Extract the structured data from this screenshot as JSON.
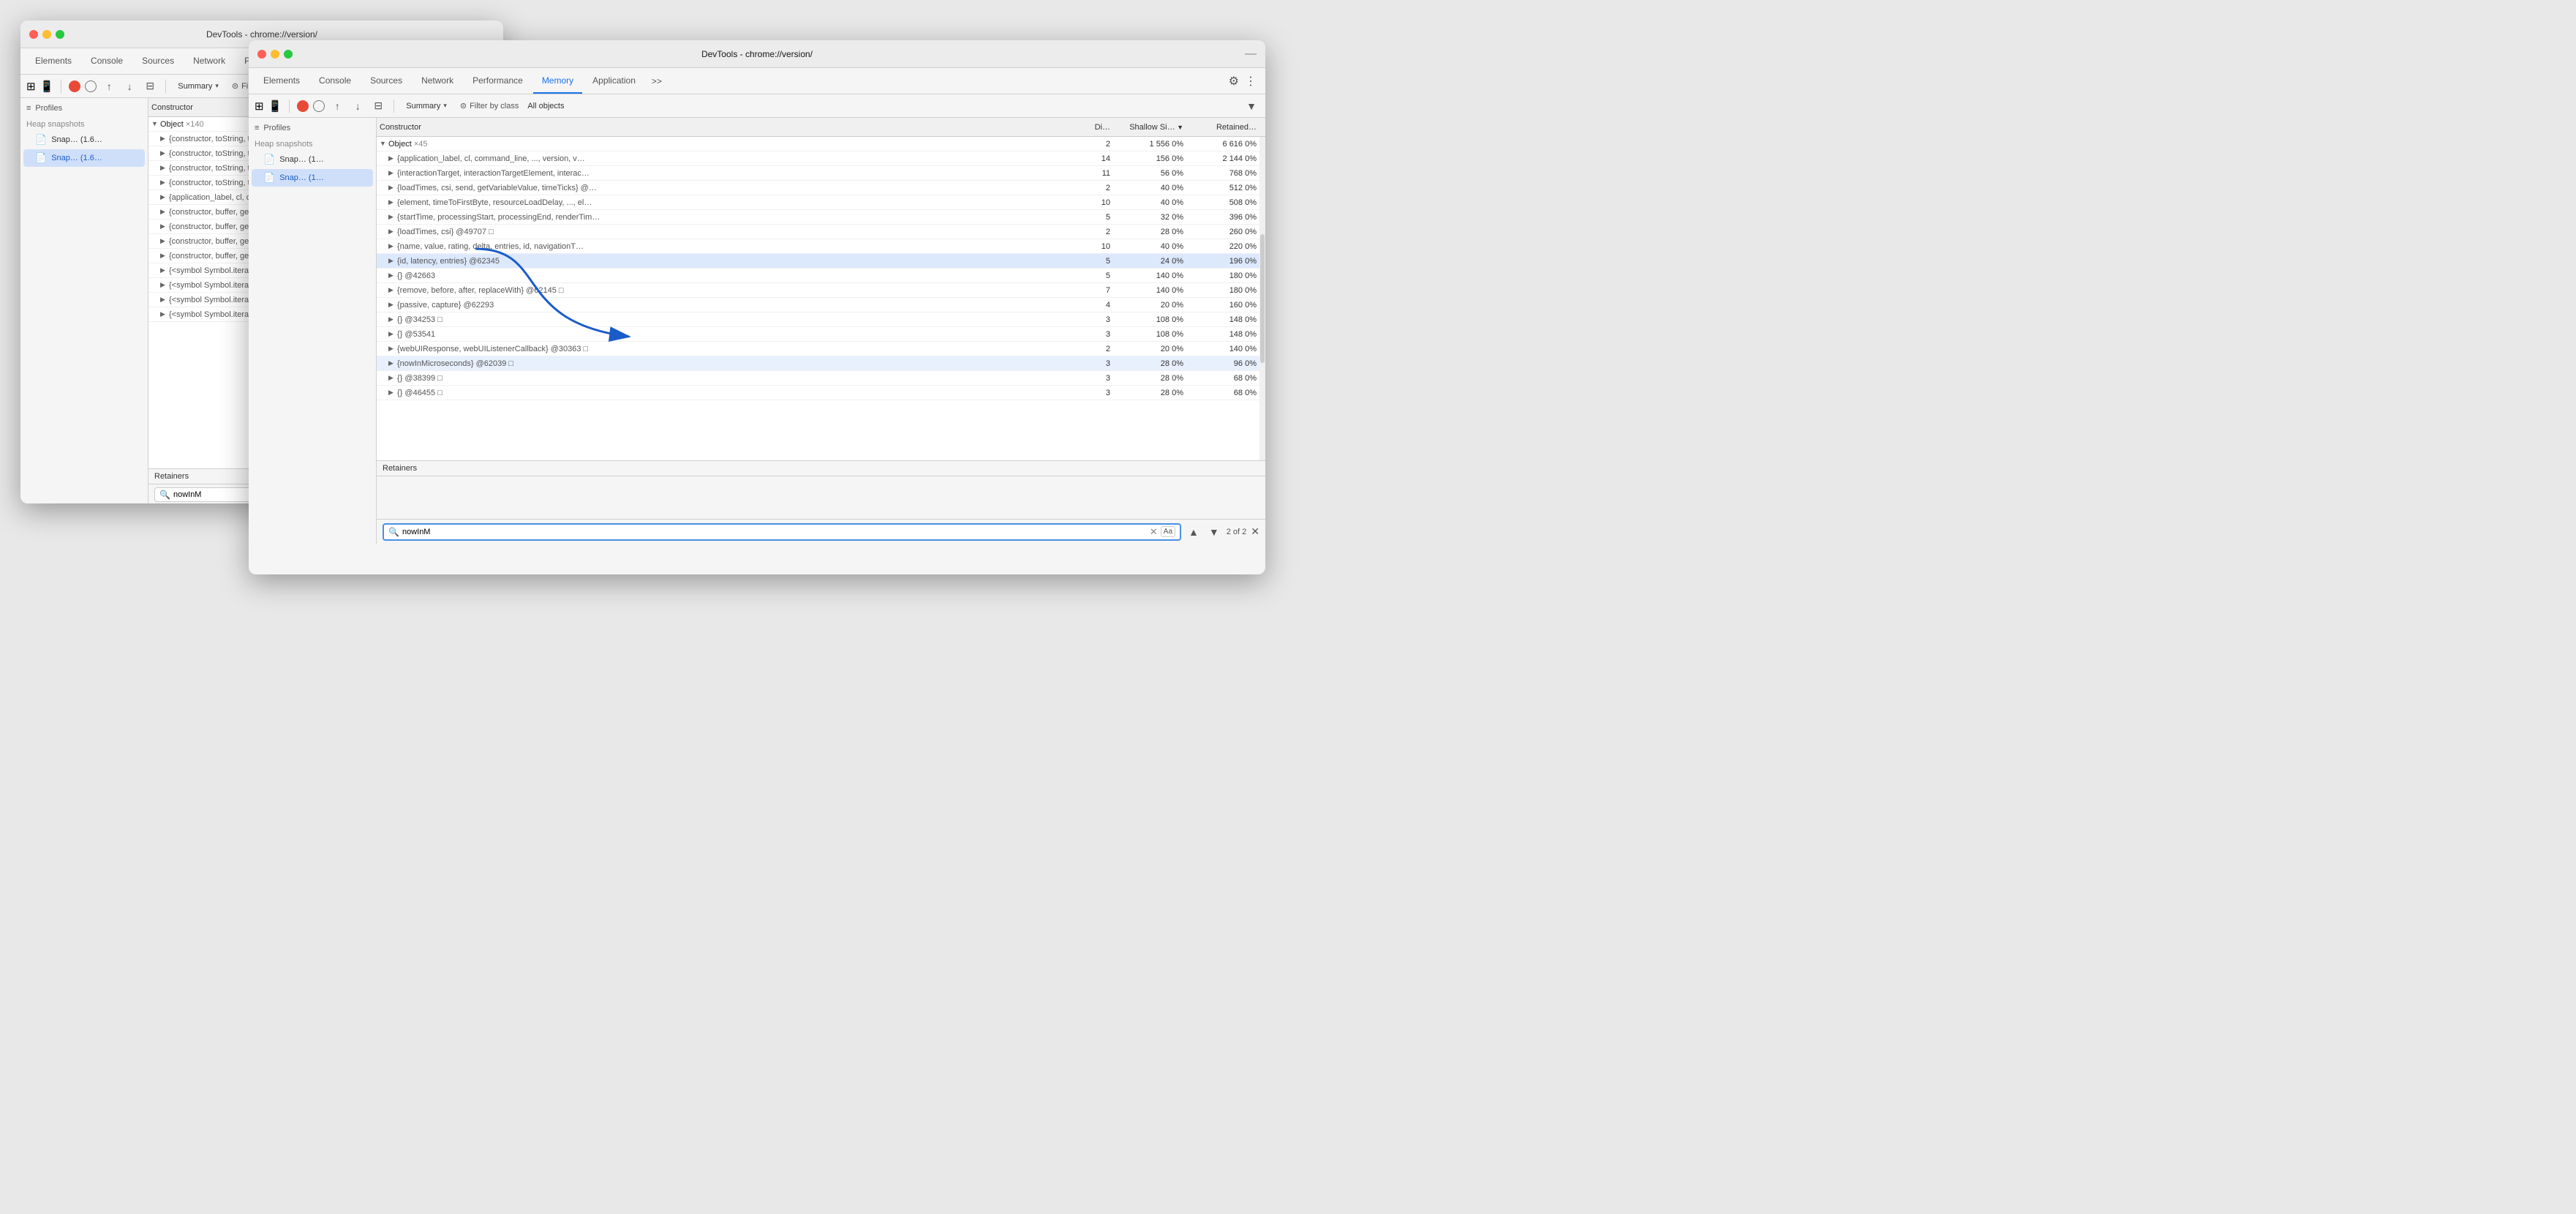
{
  "window1": {
    "title": "DevTools - chrome://version/",
    "tabs": [
      "Elements",
      "Console",
      "Sources",
      "Network",
      "Performance",
      "Memory",
      "Application",
      ">>"
    ],
    "activeTab": "Memory",
    "toolbar": {
      "summary_label": "Summary",
      "filter_label": "Filter by class",
      "all_objects_label": "All objects"
    },
    "sidebar": {
      "profiles_label": "Profiles",
      "heap_snapshots_label": "Heap snapshots",
      "snap1_label": "Snap… (1.6…",
      "snap2_label": "Snap… (1.6…"
    },
    "constructor_header": "Constructor",
    "object_label": "Object",
    "object_count": "×140",
    "rows": [
      "{constructor, toString, toDateString, ..., toLocaleT…",
      "{constructor, toString, toDateString, ..., toLocaleT…",
      "{constructor, toString, toDateString, ..., toLocaleT…",
      "{constructor, toString, toDateString, ..., toLocaleT…",
      "{application_label, cl, command_line, ..., version, …",
      "{constructor, buffer, get buffer, byteLength, get by…",
      "{constructor, buffer, get buffer, byteLength, get by…",
      "{constructor, buffer, get buffer, byteLength, get by…",
      "{constructor, buffer, get buffer, byteLength, get by…",
      "{<symbol Symbol.iterator>, constructor, get construct…",
      "{<symbol Symbol.iterator>, constructor, get construct…",
      "{<symbol Symbol.iterator>, constructor, get construct…",
      "{<symbol Symbol.iterator>, constructor, get construct…"
    ],
    "retainers_label": "Retainers",
    "search_value": "nowInM"
  },
  "window2": {
    "title": "DevTools - chrome://version/",
    "tabs": [
      "Elements",
      "Console",
      "Sources",
      "Network",
      "Performance",
      "Memory",
      "Application",
      ">>"
    ],
    "activeTab": "Memory",
    "toolbar": {
      "summary_label": "Summary",
      "filter_label": "Filter by class",
      "all_objects_label": "All objects"
    },
    "sidebar": {
      "profiles_label": "Profiles",
      "heap_snapshots_label": "Heap snapshots",
      "snap1_label": "Snap… (1…",
      "snap2_label": "Snap… (1…"
    },
    "columns": {
      "constructor": "Constructor",
      "distance": "Di…",
      "shallow": "Shallow Si…",
      "retained": "Retained…"
    },
    "object_label": "Object",
    "object_count": "×45",
    "rows": [
      {
        "label": "{application_label, cl, command_line, ..., version, v…",
        "di": "14",
        "shallow": "156  0%",
        "retained": "2 144  0%"
      },
      {
        "label": "{interactionTarget, interactionTargetElement, interac…",
        "di": "11",
        "shallow": "56  0%",
        "retained": "768  0%"
      },
      {
        "label": "{loadTimes, csi, send, getVariableValue, timeTicks} @…",
        "di": "2",
        "shallow": "40  0%",
        "retained": "512  0%"
      },
      {
        "label": "{element, timeToFirstByte, resourceLoadDelay, ..., el…",
        "di": "10",
        "shallow": "40  0%",
        "retained": "508  0%"
      },
      {
        "label": "{startTime, processingStart, processingEnd, renderTim…",
        "di": "5",
        "shallow": "32  0%",
        "retained": "396  0%"
      },
      {
        "label": "{loadTimes, csi} @49707 □",
        "di": "2",
        "shallow": "28  0%",
        "retained": "260  0%"
      },
      {
        "label": "{name, value, rating, delta, entries, id, navigationT…",
        "di": "10",
        "shallow": "40  0%",
        "retained": "220  0%"
      },
      {
        "label": "{id, latency, entries} @62345",
        "di": "5",
        "shallow": "24  0%",
        "retained": "196  0%",
        "highlighted": true
      },
      {
        "label": "{} @42663",
        "di": "5",
        "shallow": "140  0%",
        "retained": "180  0%"
      },
      {
        "label": "{remove, before, after, replaceWith} @62145 □",
        "di": "7",
        "shallow": "140  0%",
        "retained": "180  0%"
      },
      {
        "label": "{passive, capture} @62293",
        "di": "4",
        "shallow": "20  0%",
        "retained": "160  0%"
      },
      {
        "label": "{} @34253 □",
        "di": "3",
        "shallow": "108  0%",
        "retained": "148  0%"
      },
      {
        "label": "{} @53541",
        "di": "3",
        "shallow": "108  0%",
        "retained": "148  0%"
      },
      {
        "label": "{webUIResponse, webUIListenerCallback} @30363 □",
        "di": "2",
        "shallow": "20  0%",
        "retained": "140  0%"
      },
      {
        "label": "{nowInMicroseconds} @62039 □",
        "di": "3",
        "shallow": "28  0%",
        "retained": "96  0%",
        "highlighted2": true
      },
      {
        "label": "{} @38399 □",
        "di": "3",
        "shallow": "28  0%",
        "retained": "68  0%"
      },
      {
        "label": "{} @46455 □",
        "di": "3",
        "shallow": "28  0%",
        "retained": "68  0%"
      }
    ],
    "object_row_di": "2",
    "object_row_shallow": "1 556  0%",
    "object_row_retained": "6 616  0%",
    "retainers_label": "Retainers",
    "search": {
      "value": "nowInM",
      "count": "2 of 2",
      "placeholder": "Search"
    }
  },
  "arrow": {
    "visible": true
  }
}
